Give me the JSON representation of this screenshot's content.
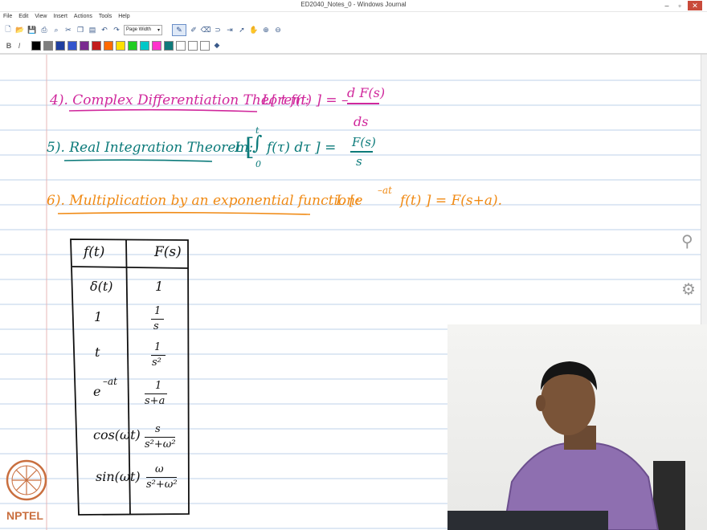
{
  "window": {
    "title": "ED2040_Notes_0 - Windows Journal",
    "minimize": "–",
    "maximize": "▫",
    "close": "✕"
  },
  "menu": [
    "File",
    "Edit",
    "View",
    "Insert",
    "Actions",
    "Tools",
    "Help"
  ],
  "toolbar": {
    "zoom_select": "Page Width"
  },
  "format": {
    "bold": "B",
    "italic": "I"
  },
  "palette": [
    "#000000",
    "#7f7f7f",
    "#1f3fa0",
    "#3355cc",
    "#7a2b8f",
    "#c21c1c",
    "#ff6a00",
    "#ffe000",
    "#22cc22",
    "#00c8c8",
    "#ff33cc",
    "#0f7a7a",
    "#ffffff",
    "#ffffff",
    "#ffffff"
  ],
  "notes": {
    "t4_label": "4). Complex Differentiation Theorem:",
    "t4_lhs": "L[ t f(t) ] = –",
    "t4_num": "d F(s)",
    "t4_den": "ds",
    "t5_label": "5). Real Integration Theorem:",
    "t5_L": "L",
    "t5_upper": "t",
    "t5_lower": "0",
    "t5_expr": "f(τ) dτ ] =",
    "t5_num": "F(s)",
    "t5_den": "s",
    "t6_label": "6). Multiplication by an exponential function:",
    "t6_L": "L [e",
    "t6_sup": "–at",
    "t6_rest": "f(t) ] = F(s+a).",
    "table_head": [
      "f(t)",
      "F(s)"
    ],
    "rows": [
      {
        "ft": "δ(t)",
        "Fs": "1"
      },
      {
        "ft": "1",
        "num": "1",
        "den": "s"
      },
      {
        "ft": "t",
        "num": "1",
        "den": "s²"
      },
      {
        "ft": "e",
        "ft_sup": "–at",
        "num": "1",
        "den": "s+a"
      },
      {
        "ft": "cos(ωt)",
        "num": "s",
        "den": "s²+ω²"
      },
      {
        "ft": "sin(ωt)",
        "num": "ω",
        "den": "s²+ω²"
      }
    ]
  },
  "logo": {
    "text": "NPTEL"
  }
}
